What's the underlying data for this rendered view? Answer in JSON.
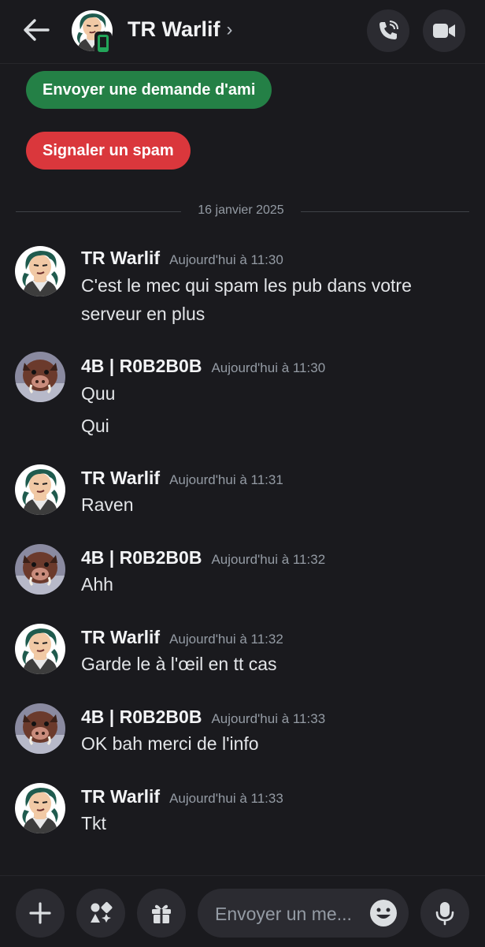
{
  "header": {
    "title": "TR Warlif",
    "chevron": "›",
    "icons": {
      "back": "arrow-left",
      "call": "phone-icon",
      "video": "video-camera-icon"
    }
  },
  "actions": {
    "friend_request": "Envoyer une demande d'ami",
    "report_spam": "Signaler un spam"
  },
  "divider_date": "16 janvier 2025",
  "messages": [
    {
      "author": "TR Warlif",
      "time": "Aujourd'hui à 11:30",
      "lines": [
        "C'est le mec qui spam les pub dans votre",
        "serveur en plus"
      ]
    },
    {
      "author": "4B | R0B2B0B",
      "time": "Aujourd'hui à 11:30",
      "lines": [
        "Quu",
        "Qui"
      ]
    },
    {
      "author": "TR Warlif",
      "time": "Aujourd'hui à 11:31",
      "lines": [
        "Raven"
      ]
    },
    {
      "author": "4B | R0B2B0B",
      "time": "Aujourd'hui à 11:32",
      "lines": [
        "Ahh"
      ]
    },
    {
      "author": "TR Warlif",
      "time": "Aujourd'hui à 11:32",
      "lines": [
        "Garde le à l'œil en tt cas"
      ]
    },
    {
      "author": "4B | R0B2B0B",
      "time": "Aujourd'hui à 11:33",
      "lines": [
        "OK bah merci de l'info"
      ]
    },
    {
      "author": "TR Warlif",
      "time": "Aujourd'hui à 11:33",
      "lines": [
        "Tkt"
      ]
    }
  ],
  "composer": {
    "placeholder": "Envoyer un me...",
    "icons": [
      "plus-icon",
      "apps-icon",
      "gift-icon",
      "emoji-icon",
      "microphone-icon"
    ]
  },
  "colors": {
    "background": "#1a1a1e",
    "green": "#248046",
    "red": "#da373c",
    "online": "#23a55a"
  }
}
